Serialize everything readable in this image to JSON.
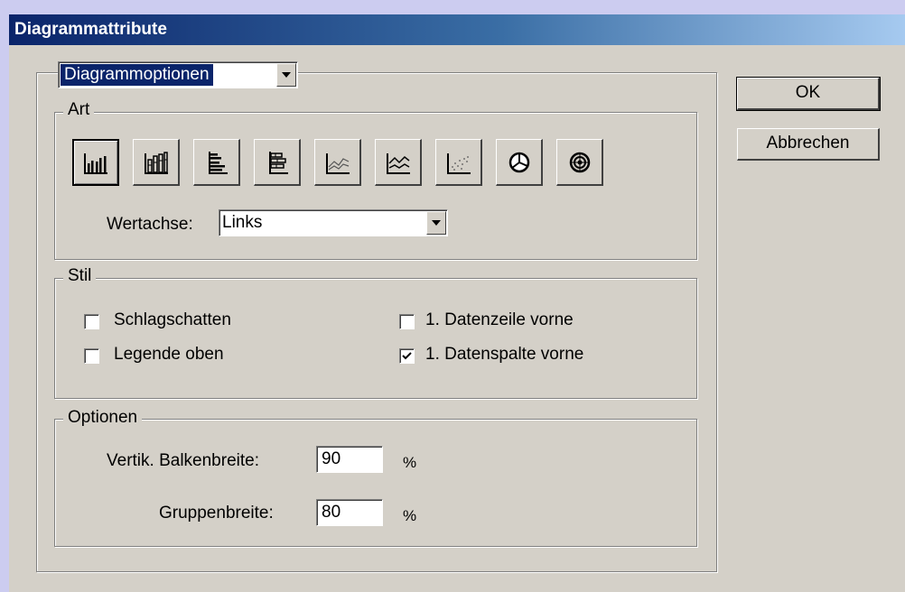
{
  "window": {
    "title": "Diagrammattribute"
  },
  "section_select": {
    "value": "Diagrammoptionen"
  },
  "art": {
    "legend": "Art",
    "types": [
      {
        "icon": "grouped-column-chart-icon",
        "selected": true
      },
      {
        "icon": "stacked-column-chart-icon",
        "selected": false
      },
      {
        "icon": "grouped-bar-chart-icon",
        "selected": false
      },
      {
        "icon": "stacked-bar-chart-icon",
        "selected": false
      },
      {
        "icon": "line-chart-icon",
        "selected": false
      },
      {
        "icon": "area-chart-icon",
        "selected": false
      },
      {
        "icon": "scatter-chart-icon",
        "selected": false
      },
      {
        "icon": "pie-chart-icon",
        "selected": false
      },
      {
        "icon": "radar-chart-icon",
        "selected": false
      }
    ],
    "value_axis_label": "Wertachse:",
    "value_axis_value": "Links"
  },
  "stil": {
    "legend": "Stil",
    "drop_shadow": {
      "label": "Schlagschatten",
      "checked": false
    },
    "legend_top": {
      "label": "Legende oben",
      "checked": false
    },
    "first_row_front": {
      "label": "1. Datenzeile vorne",
      "checked": false
    },
    "first_column_front": {
      "label": "1. Datenspalte vorne",
      "checked": true
    }
  },
  "optionen": {
    "legend": "Optionen",
    "bar_width_label": "Vertik. Balkenbreite:",
    "bar_width_value": "90",
    "group_width_label": "Gruppenbreite:",
    "group_width_value": "80",
    "percent_symbol": "%"
  },
  "buttons": {
    "ok": "OK",
    "cancel": "Abbrechen"
  }
}
